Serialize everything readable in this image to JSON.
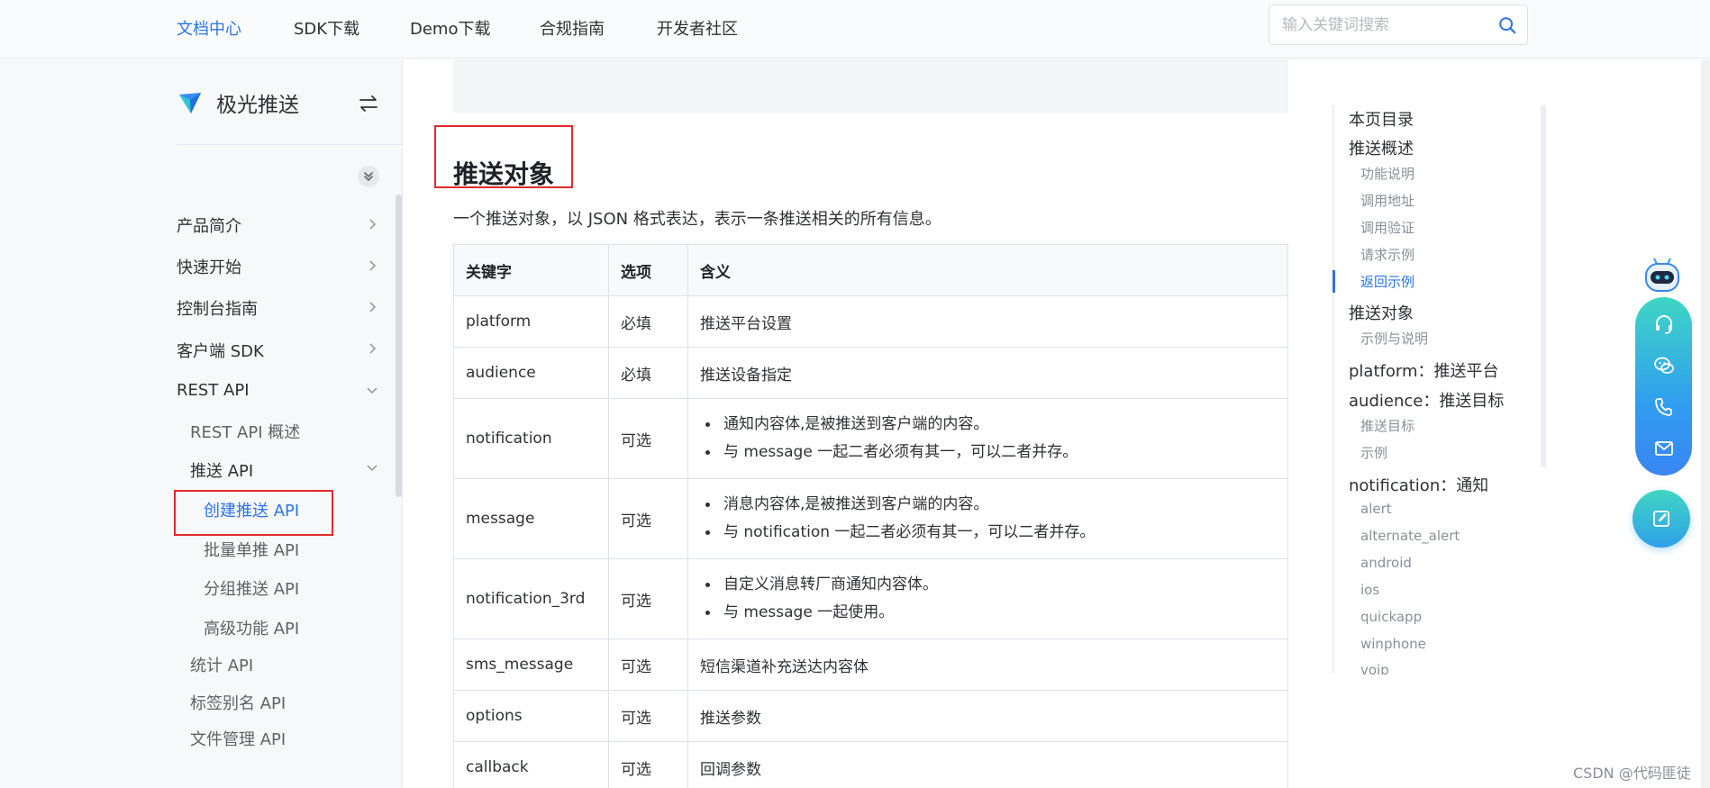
{
  "topnav": {
    "items": [
      "文档中心",
      "SDK下载",
      "Demo下载",
      "合规指南",
      "开发者社区"
    ],
    "active_index": 0,
    "search_placeholder": "输入关键词搜索"
  },
  "sidebar": {
    "brand": "极光推送",
    "items": [
      "产品简介",
      "快速开始",
      "控制台指南",
      "客户端 SDK",
      "REST API"
    ],
    "rest_api_children": [
      "REST API 概述",
      "推送 API"
    ],
    "push_api_children": [
      "创建推送 API",
      "批量单推 API",
      "分组推送 API",
      "高级功能 API"
    ],
    "more_children": [
      "统计 API",
      "标签别名 API",
      "文件管理 API"
    ]
  },
  "content": {
    "title": "推送对象",
    "description": "一个推送对象，以 JSON 格式表达，表示一条推送相关的所有信息。",
    "table": {
      "headers": [
        "关键字",
        "选项",
        "含义"
      ],
      "rows": [
        {
          "key": "platform",
          "option": "必填",
          "meaning": [
            "推送平台设置"
          ]
        },
        {
          "key": "audience",
          "option": "必填",
          "meaning": [
            "推送设备指定"
          ]
        },
        {
          "key": "notification",
          "option": "可选",
          "meaning": [
            "通知内容体,是被推送到客户端的内容。",
            "与 message 一起二者必须有其一，可以二者并存。"
          ]
        },
        {
          "key": "message",
          "option": "可选",
          "meaning": [
            "消息内容体,是被推送到客户端的内容。",
            "与 notification 一起二者必须有其一，可以二者并存。"
          ]
        },
        {
          "key": "notification_3rd",
          "option": "可选",
          "meaning": [
            "自定义消息转厂商通知内容体。",
            "与 message 一起使用。"
          ]
        },
        {
          "key": "sms_message",
          "option": "可选",
          "meaning": [
            "短信渠道补充送达内容体"
          ]
        },
        {
          "key": "options",
          "option": "可选",
          "meaning": [
            "推送参数"
          ]
        },
        {
          "key": "callback",
          "option": "可选",
          "meaning": [
            "回调参数"
          ]
        }
      ]
    }
  },
  "toc": {
    "title": "本页目录",
    "entries": [
      {
        "text": "推送概述",
        "level": 1
      },
      {
        "text": "功能说明",
        "level": 2
      },
      {
        "text": "调用地址",
        "level": 2
      },
      {
        "text": "调用验证",
        "level": 2
      },
      {
        "text": "请求示例",
        "level": 2
      },
      {
        "text": "返回示例",
        "level": 2,
        "active": true
      },
      {
        "text": "推送对象",
        "level": 1
      },
      {
        "text": "示例与说明",
        "level": 2
      },
      {
        "text": "platform：推送平台",
        "level": 1
      },
      {
        "text": "audience：推送目标",
        "level": 1
      },
      {
        "text": "推送目标",
        "level": 2
      },
      {
        "text": "示例",
        "level": 2
      },
      {
        "text": "notification：通知",
        "level": 1
      },
      {
        "text": "alert",
        "level": 2
      },
      {
        "text": "alternate_alert",
        "level": 2
      },
      {
        "text": "android",
        "level": 2
      },
      {
        "text": "ios",
        "level": 2
      },
      {
        "text": "quickapp",
        "level": 2
      },
      {
        "text": "winphone",
        "level": 2
      },
      {
        "text": "voip",
        "level": 2
      }
    ]
  },
  "floating": {
    "icons": [
      "robot-icon",
      "headset-icon",
      "wechat-icon",
      "phone-icon",
      "mail-icon",
      "edit-icon"
    ]
  },
  "watermark": "CSDN @代码匪徒",
  "colors": {
    "accent": "#2d74e8",
    "highlight": "#e02a2a",
    "panel_top": "#3fd6c3",
    "panel_bottom": "#3a86f2"
  }
}
